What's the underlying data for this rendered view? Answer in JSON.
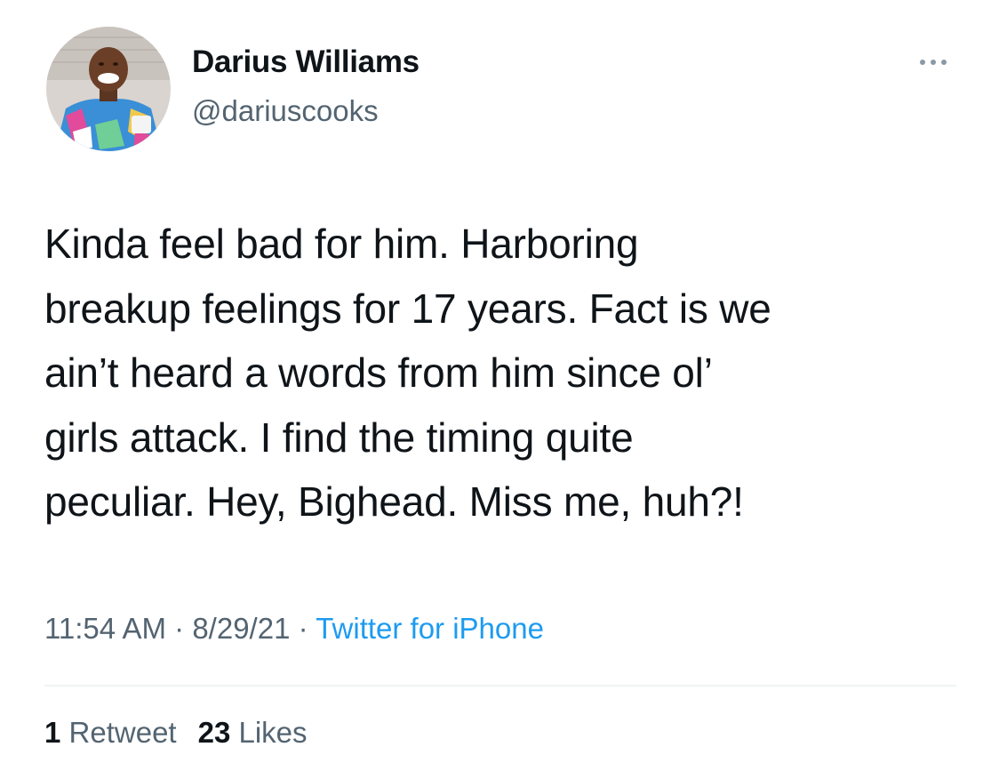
{
  "user": {
    "display_name": "Darius Williams",
    "handle": "@dariuscooks",
    "avatar_icon": "profile-photo"
  },
  "more_icon": "ellipsis-icon",
  "tweet": {
    "lines": [
      "Kinda feel bad for him. Harboring",
      "breakup feelings for 17 years. Fact is we",
      "ain’t heard a words from him since ol’",
      "girls attack. I find the timing quite",
      "peculiar. Hey, Bighead. Miss me, huh?!"
    ]
  },
  "meta": {
    "time": "11:54 AM",
    "separator": "·",
    "date": "8/29/21",
    "source": "Twitter for iPhone"
  },
  "stats": {
    "retweet_count": "1",
    "retweet_label": "Retweet",
    "like_count": "23",
    "like_label": "Likes"
  },
  "colors": {
    "text": "#0f1419",
    "secondary": "#536471",
    "link": "#1d9bf0",
    "divider": "#eff3f4"
  }
}
